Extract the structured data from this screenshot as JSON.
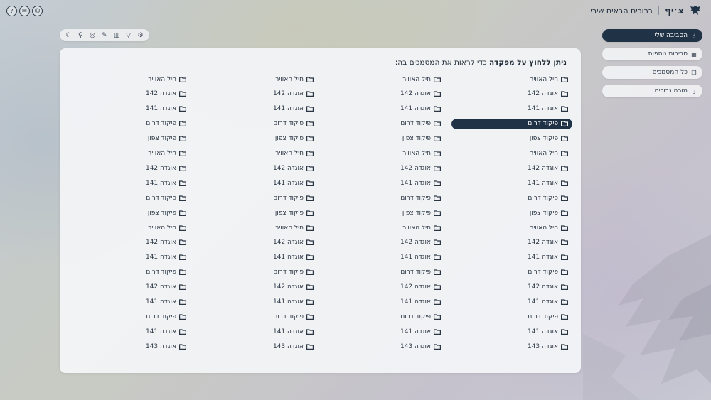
{
  "header": {
    "brand": "צ׳יף",
    "greeting": "ברוכים הבאים שירי",
    "icons": [
      "help-icon",
      "chat-icon",
      "support-icon"
    ]
  },
  "sidebar": {
    "items": [
      {
        "label": "הסביבה שלי",
        "icon": "hand-icon",
        "active": true
      },
      {
        "label": "סביבות נוספות",
        "icon": "map-icon",
        "active": false
      },
      {
        "label": "כל המסמכים",
        "icon": "copy-icon",
        "active": false
      },
      {
        "label": "מורה נבוכים",
        "icon": "book-icon",
        "active": false
      }
    ]
  },
  "toolbar": {
    "icons": [
      "moon-icon",
      "search-icon",
      "user-icon",
      "edit-icon",
      "columns-icon",
      "filter-icon",
      "settings-icon"
    ]
  },
  "main": {
    "title_bold": "ניתן ללחוץ על מפקדה",
    "title_rest": " כדי לראות את המסמכים בה:",
    "selected_accent": "#1f3246",
    "columns": [
      [
        "חיל האוויר",
        "אוגדה 142",
        "אוגדה 141",
        "פיקוד דרום",
        "פיקוד צפון",
        "חיל האוויר",
        "אוגדה 142",
        "אוגדה 141",
        "פיקוד דרום",
        "פיקוד צפון",
        "חיל האוויר",
        "אוגדה 142",
        "אוגדה 141",
        "פיקוד דרום",
        "אוגדה 142",
        "אוגדה 141",
        "פיקוד דרום",
        "אוגדה 141",
        "אוגדה 143"
      ],
      [
        "חיל האוויר",
        "אוגדה 142",
        "אוגדה 141",
        "פיקוד דרום",
        "פיקוד צפון",
        "חיל האוויר",
        "אוגדה 142",
        "אוגדה 141",
        "פיקוד דרום",
        "פיקוד צפון",
        "חיל האוויר",
        "אוגדה 142",
        "אוגדה 141",
        "פיקוד דרום",
        "אוגדה 142",
        "אוגדה 141",
        "פיקוד דרום",
        "אוגדה 141",
        "אוגדה 143"
      ],
      [
        "חיל האוויר",
        "אוגדה 142",
        "אוגדה 141",
        "פיקוד דרום",
        "פיקוד צפון",
        "חיל האוויר",
        "אוגדה 142",
        "אוגדה 141",
        "פיקוד דרום",
        "פיקוד צפון",
        "חיל האוויר",
        "אוגדה 142",
        "אוגדה 141",
        "פיקוד דרום",
        "אוגדה 142",
        "אוגדה 141",
        "פיקוד דרום",
        "אוגדה 141",
        "אוגדה 143"
      ],
      [
        "חיל האוויר",
        "אוגדה 142",
        "אוגדה 141",
        "פיקוד דרום",
        "פיקוד צפון",
        "חיל האוויר",
        "אוגדה 142",
        "אוגדה 141",
        "פיקוד דרום",
        "פיקוד צפון",
        "חיל האוויר",
        "אוגדה 142",
        "אוגדה 141",
        "פיקוד דרום",
        "אוגדה 142",
        "אוגדה 141",
        "פיקוד דרום",
        "אוגדה 141",
        "אוגדה 143"
      ]
    ],
    "selected": {
      "column": 0,
      "row": 3
    }
  }
}
